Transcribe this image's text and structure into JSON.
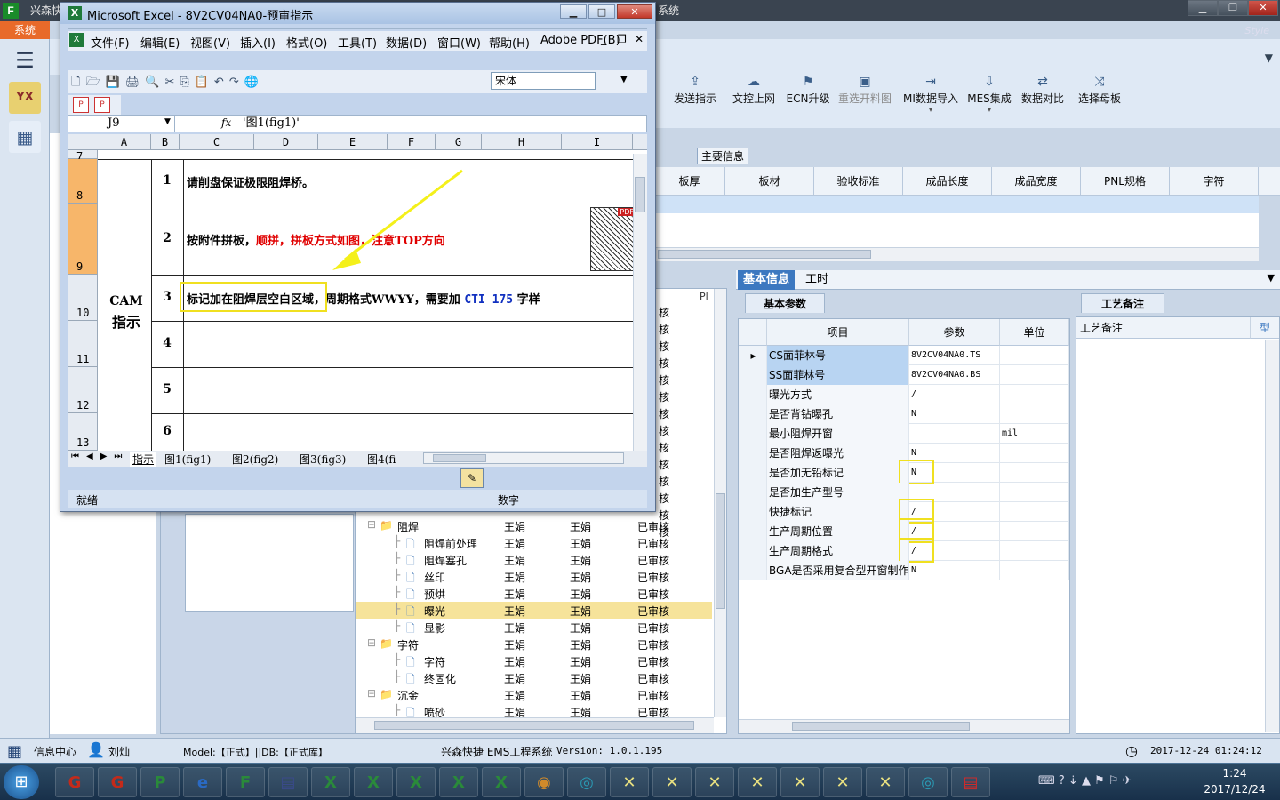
{
  "app": {
    "title": "兴森快",
    "title_tail": "系统",
    "system_tab": "系统",
    "style_label": "Style",
    "logo": "F"
  },
  "toolbar": {
    "buttons": [
      {
        "label": "发送指示",
        "icon": "upload-icon",
        "disabled": false
      },
      {
        "label": "文控上网",
        "icon": "cloud-icon",
        "disabled": false
      },
      {
        "label": "ECN升级",
        "icon": "ecn-icon",
        "disabled": false
      },
      {
        "label": "重选开料图",
        "icon": "image-icon",
        "disabled": true
      },
      {
        "label": "MI数据导入",
        "icon": "import-icon",
        "disabled": false
      },
      {
        "label": "MES集成",
        "icon": "download-icon",
        "disabled": false
      },
      {
        "label": "数据对比",
        "icon": "compare-icon",
        "disabled": false
      },
      {
        "label": "选择母板",
        "icon": "shuffle-icon",
        "disabled": false
      }
    ]
  },
  "main_info": {
    "label": "主要信息",
    "columns": [
      "板厚",
      "板材",
      "验收标准",
      "成品长度",
      "成品宽度",
      "PNL规格",
      "字符"
    ]
  },
  "tree": {
    "header_col": "Pl",
    "status_fragments": [
      "核",
      "核",
      "核",
      "核",
      "核",
      "核",
      "核",
      "核",
      "核",
      "核",
      "核",
      "核",
      "核",
      "核"
    ],
    "rows": [
      {
        "name": "阻焊",
        "folder": true,
        "indent": 0,
        "c1": "王娟",
        "c2": "王娟",
        "status": "已审核",
        "selected": false
      },
      {
        "name": "阻焊前处理",
        "folder": false,
        "indent": 1,
        "c1": "王娟",
        "c2": "王娟",
        "status": "已审核",
        "selected": false
      },
      {
        "name": "阻焊塞孔",
        "folder": false,
        "indent": 1,
        "c1": "王娟",
        "c2": "王娟",
        "status": "已审核",
        "selected": false
      },
      {
        "name": "丝印",
        "folder": false,
        "indent": 1,
        "c1": "王娟",
        "c2": "王娟",
        "status": "已审核",
        "selected": false
      },
      {
        "name": "预烘",
        "folder": false,
        "indent": 1,
        "c1": "王娟",
        "c2": "王娟",
        "status": "已审核",
        "selected": false
      },
      {
        "name": "曝光",
        "folder": false,
        "indent": 1,
        "c1": "王娟",
        "c2": "王娟",
        "status": "已审核",
        "selected": true
      },
      {
        "name": "显影",
        "folder": false,
        "indent": 1,
        "c1": "王娟",
        "c2": "王娟",
        "status": "已审核",
        "selected": false
      },
      {
        "name": "字符",
        "folder": true,
        "indent": 0,
        "c1": "王娟",
        "c2": "王娟",
        "status": "已审核",
        "selected": false
      },
      {
        "name": "字符",
        "folder": false,
        "indent": 1,
        "c1": "王娟",
        "c2": "王娟",
        "status": "已审核",
        "selected": false
      },
      {
        "name": "终固化",
        "folder": false,
        "indent": 1,
        "c1": "王娟",
        "c2": "王娟",
        "status": "已审核",
        "selected": false
      },
      {
        "name": "沉金",
        "folder": true,
        "indent": 0,
        "c1": "王娟",
        "c2": "王娟",
        "status": "已审核",
        "selected": false
      },
      {
        "name": "喷砂",
        "folder": false,
        "indent": 1,
        "c1": "王娟",
        "c2": "王娟",
        "status": "已审核",
        "selected": false
      }
    ]
  },
  "basic_info": {
    "tabs": [
      "基本信息",
      "工时"
    ],
    "param_tab": "基本参数",
    "headers": [
      "项目",
      "参数",
      "单位"
    ],
    "rows": [
      {
        "name": "CS面菲林号",
        "value": "8V2CV04NA0.TS",
        "unit": "",
        "highlight": false
      },
      {
        "name": "SS面菲林号",
        "value": "8V2CV04NA0.BS",
        "unit": "",
        "highlight": false
      },
      {
        "name": "曝光方式",
        "value": "/",
        "unit": "",
        "highlight": false
      },
      {
        "name": "是否背钻曝孔",
        "value": "N",
        "unit": "",
        "highlight": false
      },
      {
        "name": "最小阻焊开窗",
        "value": "",
        "unit": "mil",
        "highlight": false
      },
      {
        "name": "是否阻焊返曝光",
        "value": "N",
        "unit": "",
        "highlight": false
      },
      {
        "name": "是否加无铅标记",
        "value": "N",
        "unit": "",
        "highlight": true
      },
      {
        "name": "是否加生产型号",
        "value": "",
        "unit": "",
        "highlight": false
      },
      {
        "name": "快捷标记",
        "value": "/",
        "unit": "",
        "highlight": true
      },
      {
        "name": "生产周期位置",
        "value": "/",
        "unit": "",
        "highlight": true
      },
      {
        "name": "生产周期格式",
        "value": "/",
        "unit": "",
        "highlight": true
      },
      {
        "name": "BGA是否采用复合型开窗制作",
        "value": "N",
        "unit": "",
        "highlight": false
      }
    ],
    "craft_tab": "工艺备注",
    "craft_header": "工艺备注",
    "craft_col2": "型"
  },
  "statusbar": {
    "info_center": "信息中心",
    "user": "刘灿",
    "model": "Model:【正式】||DB:【正式库】",
    "product": "兴森快捷 EMS工程系统",
    "version": "Version: 1.0.1.195",
    "datetime": "2017-12-24 01:24:12"
  },
  "taskbar": {
    "time": "1:24",
    "date": "2017/12/24"
  },
  "excel": {
    "title": "Microsoft Excel - 8V2CV04NA0-预审指示",
    "menus": [
      "文件(F)",
      "编辑(E)",
      "视图(V)",
      "插入(I)",
      "格式(O)",
      "工具(T)",
      "数据(D)",
      "窗口(W)",
      "帮助(H)",
      "Adobe PDF(B)"
    ],
    "font": "宋体",
    "cell_ref": "J9",
    "fx": "fx",
    "formula": "'图1(fig1)'",
    "columns": [
      "A",
      "B",
      "C",
      "D",
      "E",
      "F",
      "G",
      "H",
      "I"
    ],
    "row_numbers": [
      "7",
      "8",
      "9",
      "10",
      "11",
      "12",
      "13"
    ],
    "section_label_1": "CAM",
    "section_label_2": "指示",
    "items": [
      {
        "num": "1",
        "text_a": "请削盘保证极限阻焊桥。",
        "text_red": "",
        "text_b": "",
        "text_blue": "",
        "text_c": ""
      },
      {
        "num": "2",
        "text_a": "按附件拼板，",
        "text_red": "顺拼，拼板方式如图，注意TOP方向",
        "text_b": "",
        "text_blue": "",
        "text_c": ""
      },
      {
        "num": "3",
        "text_a": "标记加在阻焊层空白区域",
        "text_red": "",
        "text_b": "，周期格式WWYY，需要加 ",
        "text_blue": "CTI 175",
        "text_c": " 字样"
      },
      {
        "num": "4",
        "text_a": "",
        "text_red": "",
        "text_b": "",
        "text_blue": "",
        "text_c": ""
      },
      {
        "num": "5",
        "text_a": "",
        "text_red": "",
        "text_b": "",
        "text_blue": "",
        "text_c": ""
      },
      {
        "num": "6",
        "text_a": "",
        "text_red": "",
        "text_b": "",
        "text_blue": "",
        "text_c": ""
      }
    ],
    "pdf_badge": "PDF",
    "sheet_tabs": [
      "指示",
      "图1(fig1)",
      "图2(fig2)",
      "图3(fig3)",
      "图4(fi"
    ],
    "status_ready": "就绪",
    "status_num": "数字"
  },
  "colors": {
    "accent": "#3c78c0",
    "highlight_yellow": "#f0e020",
    "selected_row": "#f6e39a",
    "red_text": "#e00000",
    "blue_text": "#1030c0"
  }
}
